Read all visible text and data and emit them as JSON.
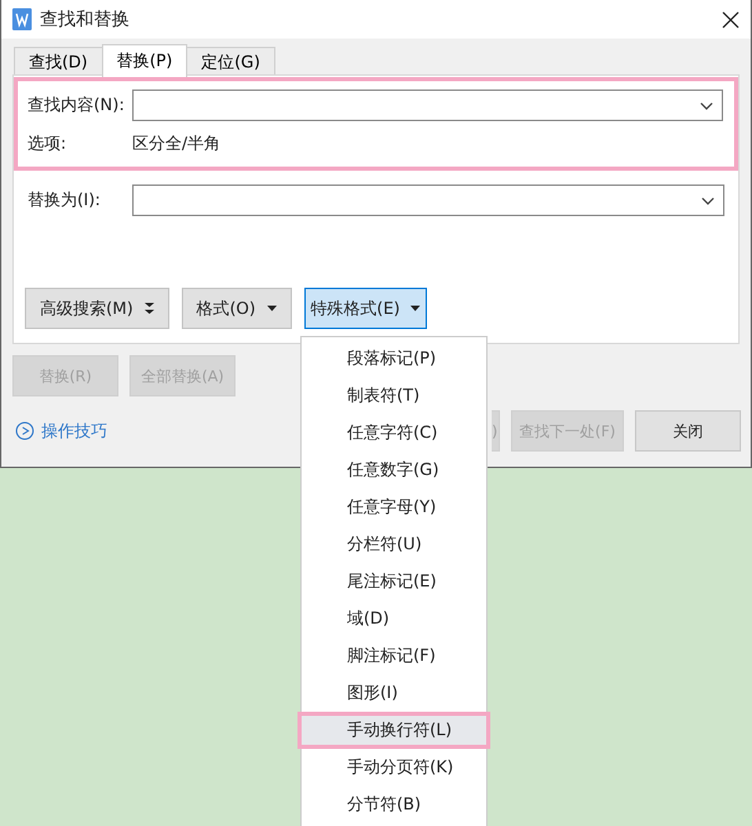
{
  "window": {
    "title": "查找和替换"
  },
  "tabs": [
    {
      "label": "查找(D)",
      "selected": false
    },
    {
      "label": "替换(P)",
      "selected": true
    },
    {
      "label": "定位(G)",
      "selected": false
    }
  ],
  "find_section": {
    "highlighted": true,
    "label": "查找内容(N):",
    "options_label": "选项:",
    "options_value": "区分全/半角"
  },
  "replace": {
    "label": "替换为(I):"
  },
  "format_buttons": [
    {
      "label": "高级搜索(M)",
      "kind": "expand",
      "selected": false
    },
    {
      "label": "格式(O)",
      "kind": "dropdown",
      "selected": false
    },
    {
      "label": "特殊格式(E)",
      "kind": "dropdown",
      "selected": true
    }
  ],
  "action_buttons": [
    {
      "label": "替换(R)",
      "disabled": true
    },
    {
      "label": "全部替换(A)",
      "disabled": true
    }
  ],
  "tips_link": "操作技巧",
  "bottom_buttons": [
    {
      "label": ")",
      "disabled": true
    },
    {
      "label": "查找下一处(F)",
      "disabled": true
    },
    {
      "label": "关闭",
      "disabled": false
    }
  ],
  "menu": [
    {
      "label": "段落标记(P)",
      "selected": false,
      "highlighted": false
    },
    {
      "label": "制表符(T)",
      "selected": false,
      "highlighted": false
    },
    {
      "label": "任意字符(C)",
      "selected": false,
      "highlighted": false
    },
    {
      "label": "任意数字(G)",
      "selected": false,
      "highlighted": false
    },
    {
      "label": "任意字母(Y)",
      "selected": false,
      "highlighted": false
    },
    {
      "label": "分栏符(U)",
      "selected": false,
      "highlighted": false
    },
    {
      "label": "尾注标记(E)",
      "selected": false,
      "highlighted": false
    },
    {
      "label": "域(D)",
      "selected": false,
      "highlighted": false
    },
    {
      "label": "脚注标记(F)",
      "selected": false,
      "highlighted": false
    },
    {
      "label": "图形(I)",
      "selected": false,
      "highlighted": false
    },
    {
      "label": "手动换行符(L)",
      "selected": true,
      "highlighted": true
    },
    {
      "label": "手动分页符(K)",
      "selected": false,
      "highlighted": false
    },
    {
      "label": "分节符(B)",
      "selected": false,
      "highlighted": false
    }
  ]
}
